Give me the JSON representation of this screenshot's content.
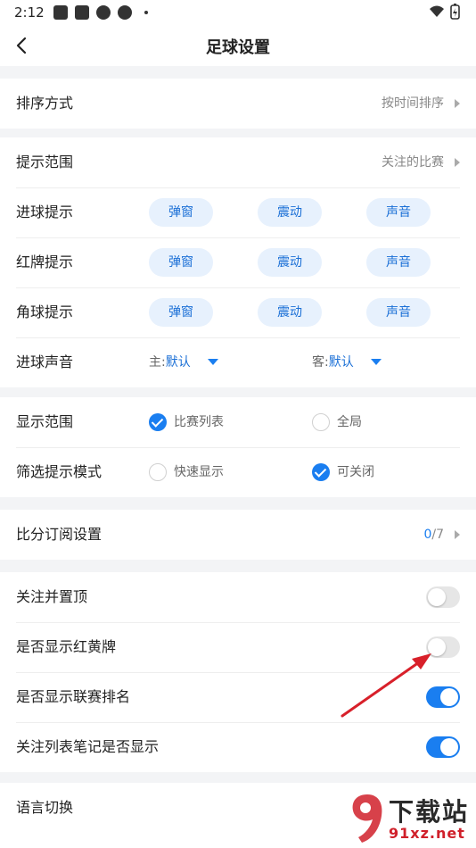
{
  "status_bar": {
    "time": "2:12"
  },
  "header": {
    "title": "足球设置"
  },
  "sort": {
    "label": "排序方式",
    "value": "按时间排序"
  },
  "prompt": {
    "range_label": "提示范围",
    "range_value": "关注的比赛",
    "rows": [
      {
        "label": "进球提示",
        "options": [
          "弹窗",
          "震动",
          "声音"
        ]
      },
      {
        "label": "红牌提示",
        "options": [
          "弹窗",
          "震动",
          "声音"
        ]
      },
      {
        "label": "角球提示",
        "options": [
          "弹窗",
          "震动",
          "声音"
        ]
      }
    ],
    "sound": {
      "label": "进球声音",
      "home_prefix": "主:",
      "home_value": "默认",
      "away_prefix": "客:",
      "away_value": "默认"
    }
  },
  "display": {
    "scope": {
      "label": "显示范围",
      "opt1": "比赛列表",
      "opt1_checked": true,
      "opt2": "全局",
      "opt2_checked": false
    },
    "filter": {
      "label": "筛选提示模式",
      "opt1": "快速显示",
      "opt1_checked": false,
      "opt2": "可关闭",
      "opt2_checked": true
    }
  },
  "subscription": {
    "label": "比分订阅设置",
    "count": "0",
    "total": "/7"
  },
  "toggles": [
    {
      "label": "关注并置顶",
      "on": false
    },
    {
      "label": "是否显示红黄牌",
      "on": false
    },
    {
      "label": "是否显示联赛排名",
      "on": true
    },
    {
      "label": "关注列表笔记是否显示",
      "on": true
    }
  ],
  "language": {
    "label": "语言切换"
  },
  "watermark": {
    "top": "下载站",
    "bottom": "91xz.net"
  },
  "colors": {
    "accent": "#1a7ef0",
    "pill_bg": "#e7f1fd",
    "page_bg": "#f3f4f6",
    "arrow": "#d8202a"
  }
}
